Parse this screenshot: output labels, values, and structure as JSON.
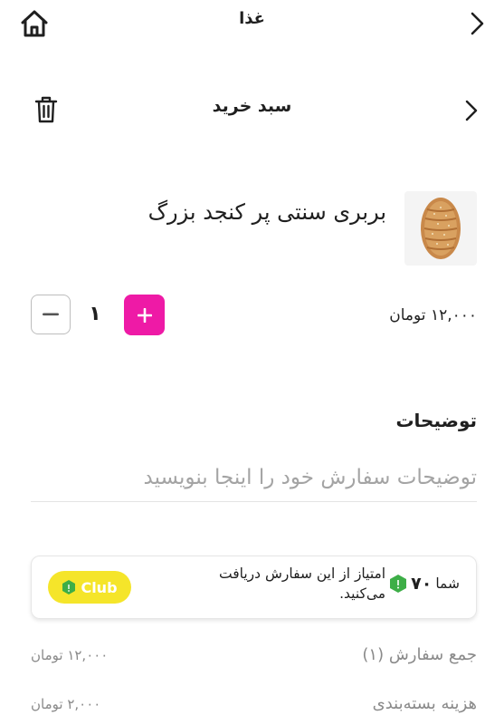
{
  "header": {
    "title": "غذا",
    "home_icon": "home-icon",
    "back_icon": "chevron-right-icon"
  },
  "cart_bar": {
    "title": "سبد خرید",
    "trash_icon": "trash-icon",
    "back_icon": "chevron-right-icon"
  },
  "product": {
    "name": "بربری سنتی پر کنجد بزرگ",
    "price": "۱۲,۰۰۰ تومان",
    "quantity": "۱",
    "image_icon": "bread-image"
  },
  "description": {
    "title": "توضیحات",
    "placeholder": "توضیحات سفارش خود را اینجا بنویسید"
  },
  "club": {
    "prefix": "شما",
    "points": "۷۰",
    "suffix": "امتیاز از این سفارش دریافت می‌کنید.",
    "badge": "Club",
    "accent": "#f5e52a",
    "gem_color": "#3dae47"
  },
  "summary": [
    {
      "label": "جمع سفارش (۱)",
      "value": "۱۲,۰۰۰ تومان"
    },
    {
      "label": "هزینه بسته‌بندی",
      "value": "۲,۰۰۰ تومان"
    }
  ],
  "colors": {
    "plus_button": "#ee1aa6"
  }
}
